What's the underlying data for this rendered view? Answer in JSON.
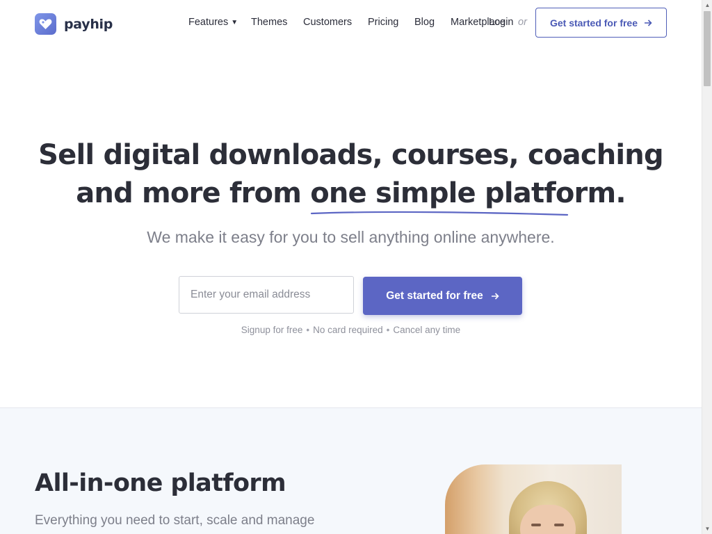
{
  "brand": {
    "name": "payhip",
    "accent": "#5c66c4"
  },
  "nav": {
    "items": [
      {
        "label": "Features",
        "has_dropdown": true
      },
      {
        "label": "Themes"
      },
      {
        "label": "Customers"
      },
      {
        "label": "Pricing"
      },
      {
        "label": "Blog"
      },
      {
        "label": "Marketplace"
      }
    ],
    "login_label": "Login",
    "or_label": "or",
    "cta_label": "Get started for free"
  },
  "hero": {
    "title_line1": "Sell digital downloads, courses, coaching",
    "title_line2_prefix": "and more from ",
    "title_line2_highlight": "one simple platform",
    "title_line2_suffix": ".",
    "subtitle": "We make it easy for you to sell anything online anywhere.",
    "email_placeholder": "Enter your email address",
    "cta_label": "Get started for free",
    "perks": [
      "Signup for free",
      "No card required",
      "Cancel any time"
    ]
  },
  "section2": {
    "title": "All-in-one platform",
    "subtitle": "Everything you need to start, scale and manage"
  },
  "icons": {
    "logo": "heart-tag-icon",
    "dropdown": "chevron-down-icon",
    "arrow": "arrow-right-icon"
  }
}
